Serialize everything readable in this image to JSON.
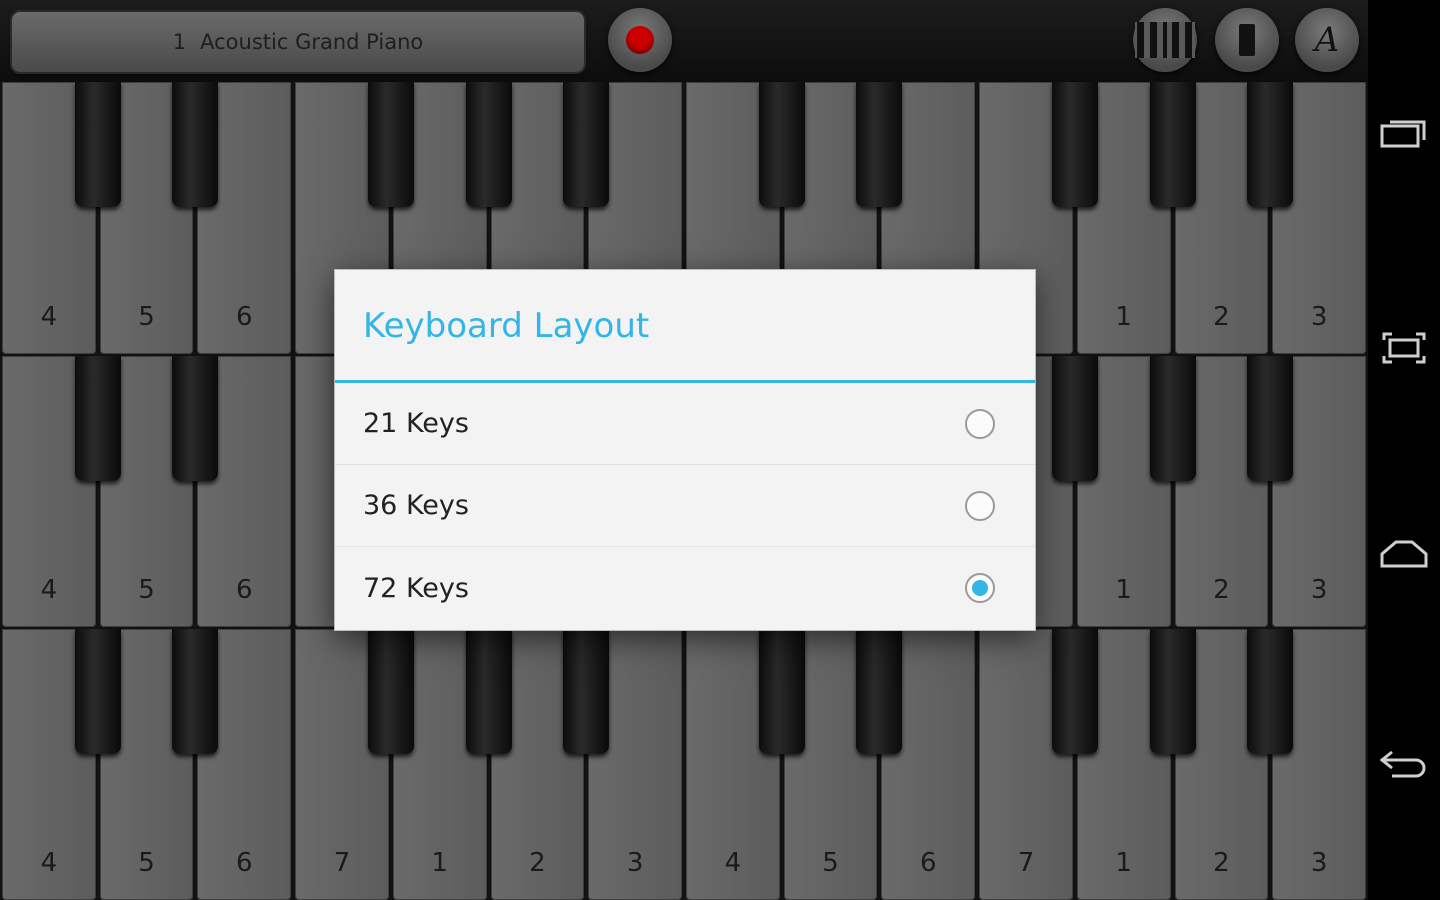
{
  "topbar": {
    "instrument_number": "1",
    "instrument_name": "Acoustic Grand Piano",
    "record_icon": "record-icon",
    "keys_icon": "piano-keys-icon",
    "single_key_icon": "single-key-icon",
    "label_icon_glyph": "A"
  },
  "keyboards": [
    {
      "labels": [
        "4",
        "5",
        "6",
        "",
        "",
        "",
        "",
        "",
        "",
        "",
        "",
        "1",
        "2",
        "3"
      ]
    },
    {
      "labels": [
        "4",
        "5",
        "6",
        "",
        "",
        "",
        "",
        "",
        "",
        "",
        "",
        "1",
        "2",
        "3"
      ]
    },
    {
      "labels": [
        "4",
        "5",
        "6",
        "7",
        "1",
        "2",
        "3",
        "4",
        "5",
        "6",
        "7",
        "1",
        "2",
        "3"
      ]
    }
  ],
  "dialog": {
    "title": "Keyboard Layout",
    "options": [
      {
        "label": "21 Keys",
        "checked": false
      },
      {
        "label": "36 Keys",
        "checked": false
      },
      {
        "label": "72 Keys",
        "checked": true
      }
    ]
  },
  "navbar": {
    "icons": [
      "recent-apps-icon",
      "fullscreen-icon",
      "home-icon",
      "back-icon"
    ]
  },
  "colors": {
    "accent": "#33b5e5",
    "record": "#cc0000"
  }
}
